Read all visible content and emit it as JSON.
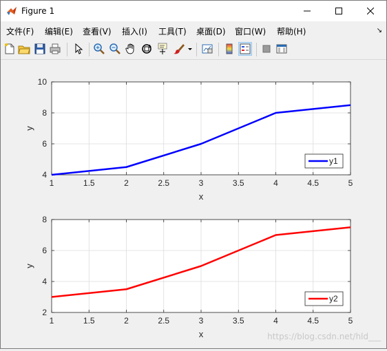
{
  "window": {
    "title": "Figure 1"
  },
  "menu": [
    "文件(F)",
    "编辑(E)",
    "查看(V)",
    "插入(I)",
    "工具(T)",
    "桌面(D)",
    "窗口(W)",
    "帮助(H)"
  ],
  "menu_arrow": "↘",
  "toolbar": {
    "icons": [
      "new-figure-icon",
      "open-file-icon",
      "save-icon",
      "print-icon",
      "pointer-icon",
      "zoom-in-icon",
      "zoom-out-icon",
      "pan-hand-icon",
      "rotate-3d-icon",
      "data-cursor-icon",
      "brush-icon",
      "link-plot-icon",
      "colorbar-icon",
      "legend-icon",
      "hide-plot-tools-icon",
      "show-plot-tools-icon"
    ]
  },
  "watermark": "https://blog.csdn.net/hld___",
  "colors": {
    "series1": "#0000ff",
    "series2": "#ff0000",
    "grid": "#dcdcdc"
  },
  "chart_data": [
    {
      "type": "line",
      "x": [
        1,
        2,
        3,
        4,
        5
      ],
      "series": [
        {
          "name": "y1",
          "values": [
            4,
            4.5,
            6,
            8,
            8.5
          ],
          "color": "#0000ff"
        }
      ],
      "xlabel": "x",
      "ylabel": "y",
      "xlim": [
        1,
        5
      ],
      "ylim": [
        4,
        10
      ],
      "xticks": [
        "1",
        "1.5",
        "2",
        "2.5",
        "3",
        "3.5",
        "4",
        "4.5",
        "5"
      ],
      "yticks": [
        "4",
        "6",
        "8",
        "10"
      ],
      "grid": true,
      "legend": "bottom-right"
    },
    {
      "type": "line",
      "x": [
        1,
        2,
        3,
        4,
        5
      ],
      "series": [
        {
          "name": "y2",
          "values": [
            3,
            3.5,
            5,
            7,
            7.5
          ],
          "color": "#ff0000"
        }
      ],
      "xlabel": "x",
      "ylabel": "y",
      "xlim": [
        1,
        5
      ],
      "ylim": [
        2,
        8
      ],
      "xticks": [
        "1",
        "1.5",
        "2",
        "2.5",
        "3",
        "3.5",
        "4",
        "4.5",
        "5"
      ],
      "yticks": [
        "2",
        "4",
        "6",
        "8"
      ],
      "grid": true,
      "legend": "bottom-right"
    }
  ]
}
